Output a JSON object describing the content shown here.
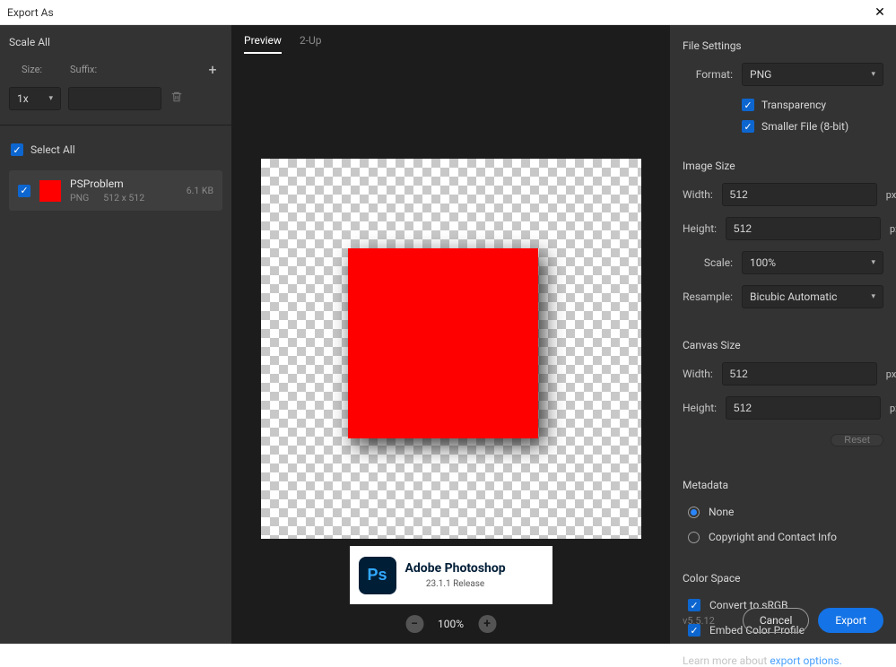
{
  "window": {
    "title": "Export As"
  },
  "left": {
    "scale_all": "Scale All",
    "size_label": "Size:",
    "suffix_label": "Suffix:",
    "size_value": "1x",
    "suffix_value": "",
    "select_all": "Select All",
    "asset": {
      "name": "PSProblem",
      "format": "PNG",
      "dims": "512 x 512",
      "filesize": "6.1 KB"
    }
  },
  "tabs": {
    "preview": "Preview",
    "twoup": "2-Up"
  },
  "ps": {
    "name": "Adobe Photoshop",
    "release": "23.1.1 Release",
    "logo": "Ps"
  },
  "zoom": {
    "value": "100%"
  },
  "right": {
    "file_settings": "File Settings",
    "format_label": "Format:",
    "format_value": "PNG",
    "transparency": "Transparency",
    "smaller_file": "Smaller File (8-bit)",
    "image_size": "Image Size",
    "width_label": "Width:",
    "height_label": "Height:",
    "width_value": "512",
    "height_value": "512",
    "px": "px",
    "scale_label": "Scale:",
    "scale_value": "100%",
    "resample_label": "Resample:",
    "resample_value": "Bicubic Automatic",
    "canvas_size": "Canvas Size",
    "canvas_width": "512",
    "canvas_height": "512",
    "reset": "Reset",
    "metadata": "Metadata",
    "meta_none": "None",
    "meta_copyright": "Copyright and Contact Info",
    "color_space": "Color Space",
    "convert_srgb": "Convert to sRGB",
    "embed_profile": "Embed Color Profile",
    "learn_more_pre": "Learn more about ",
    "learn_more_link": "export options.",
    "version": "v5.5.12",
    "cancel": "Cancel",
    "export": "Export"
  }
}
